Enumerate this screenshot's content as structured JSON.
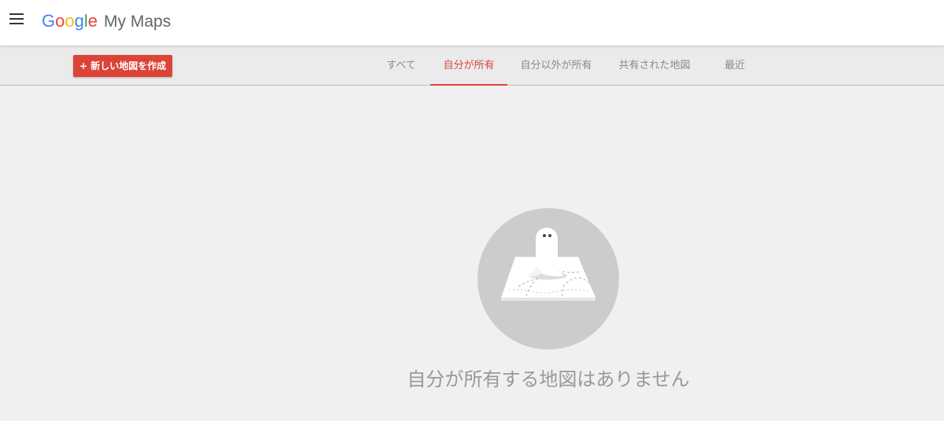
{
  "app": {
    "logo_letters": [
      "G",
      "o",
      "o",
      "g",
      "l",
      "e"
    ],
    "logo_colors": [
      "#4285f4",
      "#ea4335",
      "#fbbc05",
      "#4285f4",
      "#34a853",
      "#ea4335"
    ],
    "product_name": "My Maps"
  },
  "header": {
    "menu_icon": "hamburger-menu-icon"
  },
  "toolbar": {
    "create_label": "+ 新しい地図を作成"
  },
  "tabs": [
    {
      "label": "すべて",
      "active": false
    },
    {
      "label": "自分が所有",
      "active": true
    },
    {
      "label": "自分以外が所有",
      "active": false
    },
    {
      "label": "共有された地図",
      "active": false
    },
    {
      "label": "最近",
      "active": false
    }
  ],
  "empty_state": {
    "icon": "ghost-on-map-icon",
    "message": "自分が所有する地図はありません"
  },
  "colors": {
    "accent": "#db4437",
    "background": "#f0f0f0",
    "toolbar": "#ebebeb",
    "illustration_circle": "#cccccc"
  }
}
